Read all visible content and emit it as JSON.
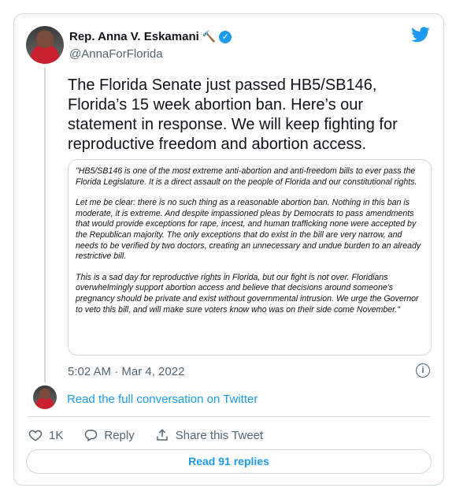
{
  "author": {
    "name": "Rep. Anna V. Eskamani",
    "handle": "@AnnaForFlorida",
    "name_emoji": "🔨"
  },
  "tweet": {
    "text": "The Florida Senate just passed HB5/SB146, Florida’s 15 week abortion ban. Here’s our statement in response. We will keep fighting for reproductive freedom and abortion access.",
    "timestamp": "5:02 AM · Mar 4, 2022"
  },
  "statement": {
    "paragraphs": [
      "\"HB5/SB146 is one of the most extreme anti-abortion and anti-freedom bills to ever pass the Florida Legislature. It is a direct assault on the people of Florida and our constitutional rights.",
      "Let me be clear: there is no such thing as a reasonable abortion ban. Nothing in this ban is moderate, it is extreme. And despite impassioned pleas by Democrats to pass amendments that would provide exceptions for rape, incest, and human trafficking none were accepted by the Republican majority. The only exceptions that do exist in the bill are very narrow, and needs to be verified by two doctors, creating an unnecessary and undue burden to an already restrictive bill.",
      "This is a sad day for reproductive rights in Florida, but our fight is not over. Floridians overwhelmingly support abortion access and believe that decisions around someone's pregnancy should be private and exist without governmental intrusion. We urge the Governor to veto this bill, and will make sure voters know who was on their side come November.\""
    ]
  },
  "conversation_link": "Read the full conversation on Twitter",
  "actions": {
    "likes": "1K",
    "reply_label": "Reply",
    "share_label": "Share this Tweet"
  },
  "read_replies_label": "Read 91 replies",
  "colors": {
    "accent": "#1d9bf0",
    "text": "#0f1419",
    "secondary": "#536471",
    "border": "#cfd9de"
  },
  "icons": [
    "twitter-bird-icon",
    "verified-badge-icon",
    "info-icon",
    "heart-icon",
    "reply-icon",
    "share-icon"
  ]
}
